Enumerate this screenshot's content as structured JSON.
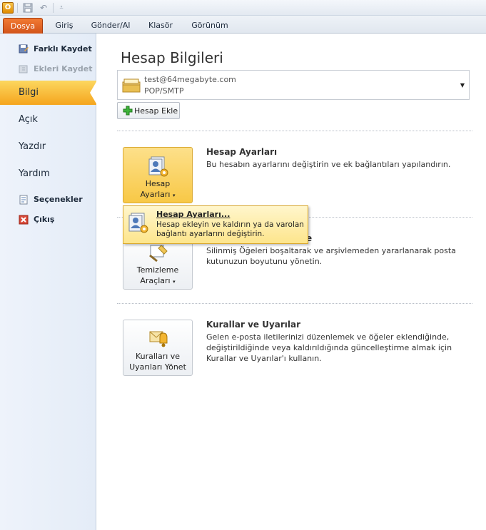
{
  "ribbon": {
    "app_icon": "outlook-icon",
    "tabs": [
      "Dosya",
      "Giriş",
      "Gönder/Al",
      "Klasör",
      "Görünüm"
    ]
  },
  "nav": {
    "commands_top": [
      {
        "label": "Farklı Kaydet",
        "icon": "save-as-icon",
        "enabled": true
      },
      {
        "label": "Ekleri Kaydet",
        "icon": "save-attachments-icon",
        "enabled": false
      }
    ],
    "items": [
      "Bilgi",
      "Açık",
      "Yazdır",
      "Yardım"
    ],
    "selected": "Bilgi",
    "commands_bottom": [
      {
        "label": "Seçenekler",
        "icon": "options-icon"
      },
      {
        "label": "Çıkış",
        "icon": "exit-icon"
      }
    ]
  },
  "main": {
    "title": "Hesap Bilgileri",
    "account": {
      "email": "test@64megabyte.com",
      "type": "POP/SMTP"
    },
    "add_account": "Hesap Ekle",
    "sections": [
      {
        "button_line1": "Hesap",
        "button_line2": "Ayarları",
        "title": "Hesap Ayarları",
        "desc": "Bu hesabın ayarlarını değiştirin ve ek bağlantıları yapılandırın."
      },
      {
        "button_line1": "Temizleme",
        "button_line2": "Araçları",
        "title_visible_part": "e",
        "desc": "Silinmiş Öğeleri boşaltarak ve arşivlemeden yararlanarak posta kutunuzun boyutunu yönetin."
      },
      {
        "button_line1": "Kuralları ve",
        "button_line2": "Uyarıları Yönet",
        "title": "Kurallar ve Uyarılar",
        "desc": "Gelen e-posta iletilerinizi düzenlemek ve öğeler eklendiğinde, değiştirildiğinde veya kaldırıldığında güncelleştirme almak için Kurallar ve Uyarılar'ı kullanın."
      }
    ],
    "popup": {
      "title": "Hesap Ayarları...",
      "desc": "Hesap ekleyin ve kaldırın ya da varolan bağlantı ayarlarını değiştirin."
    }
  },
  "colors": {
    "file_tab": "#d2531a",
    "selected_nav": "#f5a51e",
    "active_button": "#f8c846"
  }
}
